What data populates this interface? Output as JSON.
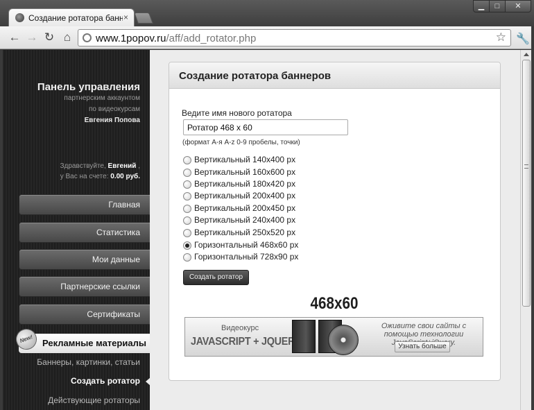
{
  "browser": {
    "tab_title": "Создание ротатора баннер",
    "tab_close": "×",
    "url_host": "www.1popov.ru",
    "url_path": "/aff/add_rotator.php",
    "window_controls": {
      "minimize": "▁",
      "maximize": "□",
      "close": "✕"
    },
    "nav_icons": {
      "back": "←",
      "forward": "→",
      "reload": "↻",
      "home": "⌂",
      "star": "☆",
      "wrench": "🔧"
    }
  },
  "sidebar": {
    "panel_title": "Панель управления",
    "subtitle_1": "партнерским аккаунтом",
    "subtitle_2": "по видеокурсам",
    "owner": "Евгения Попова",
    "greeting_prefix": "Здравствуйте,",
    "user_name": "Евгений",
    "greeting_suffix": ",",
    "balance_prefix": "у Вас на счете:",
    "balance_value": "0.00 руб.",
    "menu": [
      {
        "label": "Главная"
      },
      {
        "label": "Статистика"
      },
      {
        "label": "Мои данные"
      },
      {
        "label": "Партнерские ссылки"
      },
      {
        "label": "Сертификаты"
      }
    ],
    "active_menu": "Рекламные материалы",
    "new_badge": "New!",
    "submenu": {
      "banners": "Баннеры, картинки, статьи",
      "create_rotator": "Создать ротатор",
      "active_rotators": "Действующие ротаторы"
    }
  },
  "main": {
    "card_title": "Создание ротатора баннеров",
    "name_label": "Ведите имя нового ротатора",
    "name_value": "Ротатор 468 x 60",
    "format_hint": "(формат А-я A-z 0-9 пробелы, точки)",
    "sizes": [
      {
        "label": "Вертикальный 140x400 px",
        "checked": false
      },
      {
        "label": "Вертикальный 160x600 px",
        "checked": false
      },
      {
        "label": "Вертикальный 180x420 px",
        "checked": false
      },
      {
        "label": "Вертикальный 200x400 px",
        "checked": false
      },
      {
        "label": "Вертикальный 200x450 px",
        "checked": false
      },
      {
        "label": "Вертикальный 240x400 px",
        "checked": false
      },
      {
        "label": "Вертикальный 250x520 px",
        "checked": false
      },
      {
        "label": "Горизонтальный 468x60 px",
        "checked": true
      },
      {
        "label": "Горизонтальный 728x90 px",
        "checked": false
      }
    ],
    "create_button": "Создать ротатор",
    "preview_size": "468x60",
    "banner": {
      "course": "Видеокурс",
      "tech": "JAVASCRIPT + JQUERY",
      "promo": "Оживите свои сайты с помощью технологии JavaScript+jQuery.",
      "more_button": "Узнать больше"
    }
  }
}
